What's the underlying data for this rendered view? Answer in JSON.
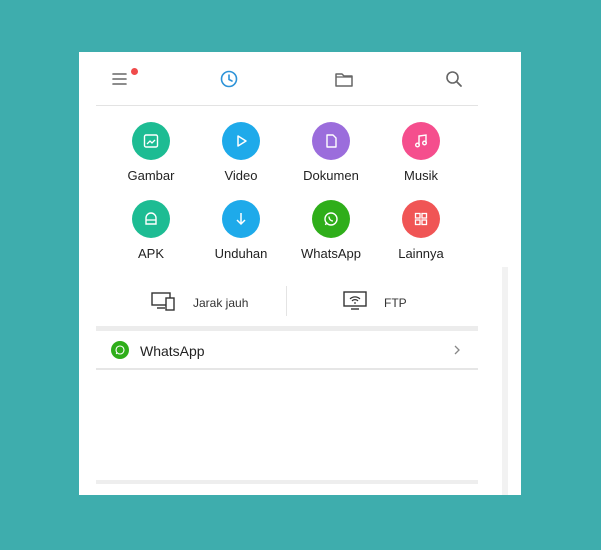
{
  "topbar": {
    "icons": [
      "menu-icon",
      "recent-clock-icon",
      "folder-icon",
      "search-icon"
    ],
    "has_notification": true
  },
  "categories": [
    {
      "label": "Gambar",
      "icon": "image-icon",
      "color": "#1dbc93"
    },
    {
      "label": "Video",
      "icon": "play-icon",
      "color": "#1eaaea"
    },
    {
      "label": "Dokumen",
      "icon": "document-icon",
      "color": "#9b6ddc"
    },
    {
      "label": "Musik",
      "icon": "music-icon",
      "color": "#f54e8d"
    },
    {
      "label": "APK",
      "icon": "apk-icon",
      "color": "#1dbc93"
    },
    {
      "label": "Unduhan",
      "icon": "download-icon",
      "color": "#1eaaea"
    },
    {
      "label": "WhatsApp",
      "icon": "whatsapp-icon",
      "color": "#2fae1a"
    },
    {
      "label": "Lainnya",
      "icon": "grid-icon",
      "color": "#f05555"
    }
  ],
  "remote": {
    "jarak_jauh": "Jarak jauh",
    "ftp": "FTP"
  },
  "recent": {
    "whatsapp_label": "WhatsApp",
    "whatsapp_color": "#2fae1a"
  },
  "colors": {
    "background": "#3eadad",
    "accent": "#2d93d8"
  }
}
